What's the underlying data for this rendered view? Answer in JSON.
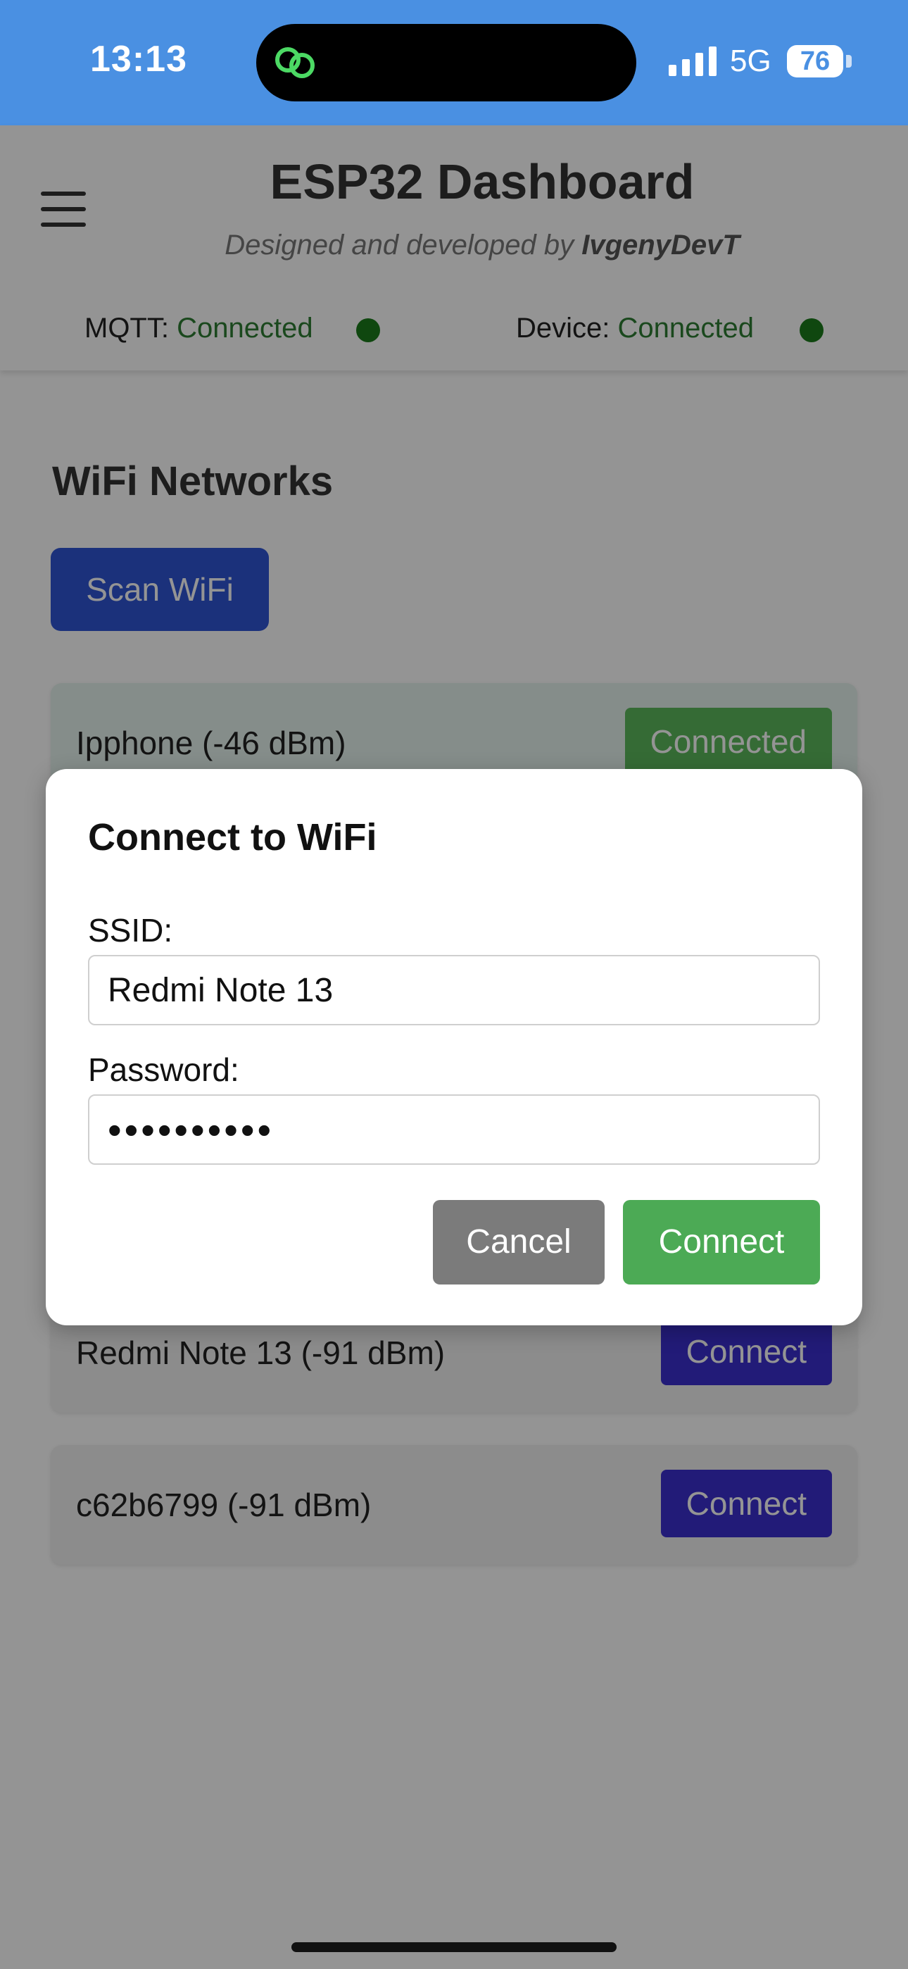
{
  "status_bar": {
    "time": "13:13",
    "network": "5G",
    "battery": "76"
  },
  "header": {
    "title": "ESP32 Dashboard",
    "subtitle_prefix": "Designed and developed by",
    "subtitle_author": "IvgenyDevT",
    "mqtt_label": "MQTT:",
    "mqtt_status": "Connected",
    "device_label": "Device:",
    "device_status": "Connected"
  },
  "main": {
    "section_title": "WiFi Networks",
    "scan_button": "Scan WiFi",
    "networks": [
      {
        "name": "Ipphone (-46 dBm)",
        "button": "Connected"
      },
      {
        "name": "Redmi Note 13 (-91 dBm)",
        "button": "Connect"
      },
      {
        "name": "c62b6799 (-91 dBm)",
        "button": "Connect"
      }
    ]
  },
  "modal": {
    "title": "Connect to WiFi",
    "ssid_label": "SSID:",
    "ssid_value": "Redmi Note 13",
    "password_label": "Password:",
    "password_value": "••••••••••",
    "cancel": "Cancel",
    "connect": "Connect"
  },
  "colors": {
    "status_bar": "#4a90e2",
    "status_ok": "#2e7d32",
    "scan_button": "#2f55d4",
    "connect_button": "#3b2fcf",
    "connected_button": "#5cb85c",
    "modal_connect": "#4caa55",
    "modal_cancel": "#7b7b7b"
  },
  "icons": [
    "app-link-icon",
    "signal-icon",
    "battery-icon",
    "hamburger-menu-icon",
    "status-dot-icon"
  ]
}
